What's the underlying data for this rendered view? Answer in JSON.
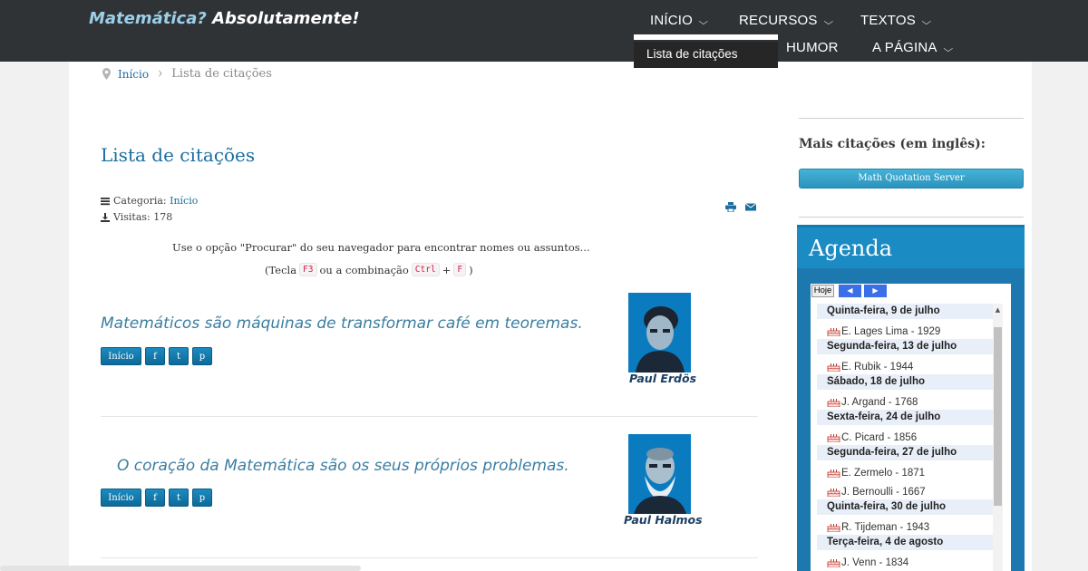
{
  "site": {
    "title_q": "Matemática?",
    "title_rest": "Absolutamente!"
  },
  "nav": {
    "items": [
      {
        "label": "INÍCIO"
      },
      {
        "label": "RECURSOS"
      },
      {
        "label": "TEXTOS"
      },
      {
        "label": "HUMOR"
      },
      {
        "label": "A PÁGINA"
      }
    ],
    "dropdown_item": "Lista de citações"
  },
  "breadcrumb": {
    "home": "Início",
    "current": "Lista de citações"
  },
  "page": {
    "title": "Lista de citações",
    "category_label": "Categoria:",
    "category_value": "Início",
    "visits_label": "Visitas:",
    "visits_value": "178",
    "instruction": "Use o opção \"Procurar\" do seu navegador para encontrar nomes ou assuntos...",
    "instruction2_prefix": "(Tecla",
    "key_f3": "F3",
    "instruction2_mid": "ou a combinação",
    "key_ctrl": "Ctrl",
    "plus": "+",
    "key_f": "F",
    "instruction2_suffix": ")"
  },
  "quotes": [
    {
      "text": "Matemáticos são máquinas de transformar café em teoremas.",
      "author": "Paul Erdös",
      "btn_home": "Início",
      "btn_f": "f",
      "btn_t": "t",
      "btn_p": "p"
    },
    {
      "text": "O coração da Matemática são os seus próprios problemas.",
      "author": "Paul Halmos",
      "btn_home": "Início",
      "btn_f": "f",
      "btn_t": "t",
      "btn_p": "p"
    }
  ],
  "sidebar": {
    "more_heading": "Mais citações (em inglês):",
    "mqs_button": "Math Quotation Server",
    "agenda_title": "Agenda",
    "today_button": "Hoje",
    "prev_icon": "chevron-left-icon",
    "next_icon": "chevron-right-icon",
    "days": [
      {
        "date": "Quinta-feira, 9 de julho",
        "events": [
          "E. Lages Lima - 1929"
        ]
      },
      {
        "date": "Segunda-feira, 13 de julho",
        "events": [
          "E. Rubik - 1944"
        ]
      },
      {
        "date": "Sábado, 18 de julho",
        "events": [
          "J. Argand - 1768"
        ]
      },
      {
        "date": "Sexta-feira, 24 de julho",
        "events": [
          "C. Picard - 1856"
        ]
      },
      {
        "date": "Segunda-feira, 27 de julho",
        "events": [
          "E. Zermelo - 1871",
          "J. Bernoulli - 1667"
        ]
      },
      {
        "date": "Quinta-feira, 30 de julho",
        "events": [
          "R. Tijdeman - 1943"
        ]
      },
      {
        "date": "Terça-feira, 4 de agosto",
        "events": [
          "J. Venn - 1834"
        ]
      }
    ]
  },
  "colors": {
    "topbar": "#303336",
    "link": "#1a6ea0",
    "agenda": "#1e78b0",
    "quote": "#3b7ea1"
  }
}
